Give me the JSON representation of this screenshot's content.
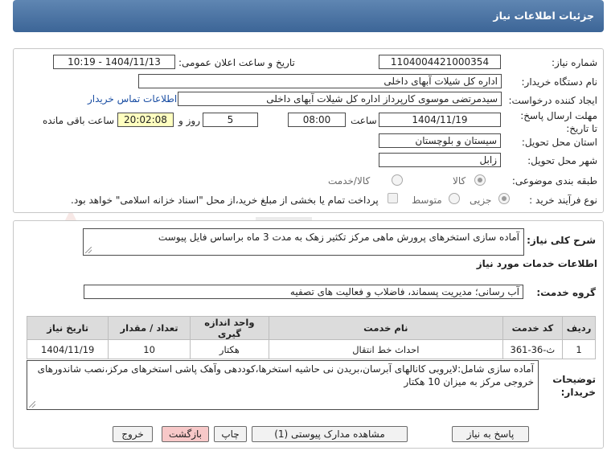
{
  "header": {
    "title": "جزئیات اطلاعات نیاز"
  },
  "fields": {
    "need_number_label": "شماره نیاز:",
    "need_number": "1104004421000354",
    "announce_label": "تاریخ و ساعت اعلان عمومی:",
    "announce_value": "1404/11/13 - 10:19",
    "buyer_org_label": "نام دستگاه خریدار:",
    "buyer_org": "اداره کل شیلات آبهای داخلی",
    "creator_label": "ایجاد کننده درخواست:",
    "creator": "سیدمرتضی موسوی کارپرداز اداره کل شیلات آبهای داخلی",
    "contact_link": "اطلاعات تماس خریدار",
    "deadline_label": "مهلت ارسال پاسخ: تا تاریخ:",
    "deadline_date": "1404/11/19",
    "time_label": "ساعت",
    "deadline_time": "08:00",
    "days_value": "5",
    "days_label": "روز و",
    "remaining_time": "20:02:08",
    "remaining_label": "ساعت باقی مانده",
    "province_label": "استان محل تحویل:",
    "province": "سیستان و بلوچستان",
    "city_label": "شهر محل تحویل:",
    "city": "زابل",
    "category_label": "طبقه بندی موضوعی:",
    "category_options": [
      "کالا",
      "کالا/خدمت"
    ],
    "purchase_type_label": "نوع فرآیند خرید :",
    "purchase_options": [
      "جزیی",
      "متوسط"
    ],
    "payment_note": "پرداخت تمام یا بخشی از مبلغ خرید،از محل \"اسناد خزانه اسلامی\" خواهد بود."
  },
  "description": {
    "label": "شرح کلی نیاز:",
    "value": "آماده سازی استخرهای پرورش ماهی مرکز تکثیر زهک به مدت 3 ماه براساس فایل پیوست"
  },
  "services": {
    "section_title": "اطلاعات خدمات مورد نیاز",
    "group_label": "گروه خدمت:",
    "group_value": "آب رسانی؛ مدیریت پسماند، فاضلاب و فعالیت های تصفیه",
    "columns": [
      "ردیف",
      "کد خدمت",
      "نام خدمت",
      "واحد اندازه گیری",
      "تعداد / مقدار",
      "تاریخ نیاز"
    ],
    "rows": [
      [
        "1",
        "ث-36-361",
        "احداث خط انتقال",
        "هکتار",
        "10",
        "1404/11/19"
      ]
    ]
  },
  "buyer_notes": {
    "label": "توضیحات خریدار:",
    "value": "آماده سازی شامل:لایروبی کانالهای آبرسان،بریدن نی حاشیه استخرها،کوددهی وآهک پاشی  استخرهای مرکز،نصب شاندورهای خروجی مرکز به میزان 10 هکتار"
  },
  "buttons": {
    "reply": "پاسخ به نیاز",
    "view_docs": "مشاهده مدارک پیوستی (1)",
    "print": "چاپ",
    "back": "بازگشت",
    "exit": "خروج"
  },
  "colors": {
    "header_bg": "#4a73a3",
    "remaining_bg": "#ffffc0",
    "link": "#1a4ea3",
    "back_btn": "#f7c8c8"
  }
}
